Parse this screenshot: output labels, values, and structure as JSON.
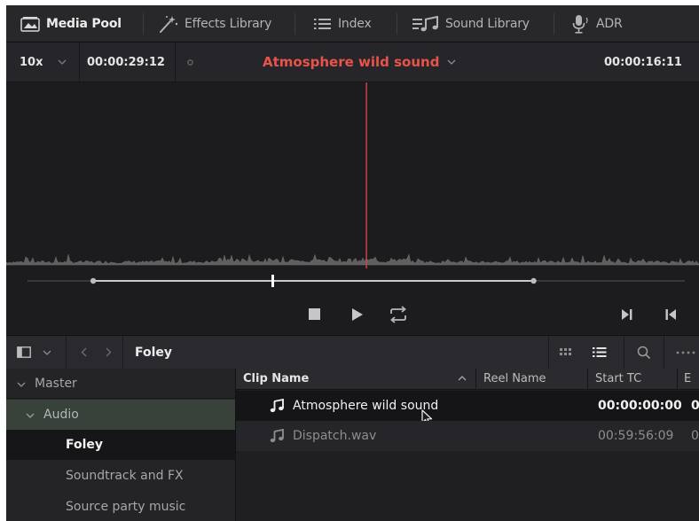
{
  "tabs": [
    {
      "label": "Media Pool",
      "icon": "media-pool-icon",
      "active": true
    },
    {
      "label": "Effects Library",
      "icon": "effects-wand-icon",
      "active": false
    },
    {
      "label": "Index",
      "icon": "index-list-icon",
      "active": false
    },
    {
      "label": "Sound Library",
      "icon": "sound-library-icon",
      "active": false
    },
    {
      "label": "ADR",
      "icon": "microphone-icon",
      "active": false
    }
  ],
  "viewer": {
    "zoom": "10x",
    "duration_tc": "00:00:29:12",
    "clip_title": "Atmosphere wild sound",
    "current_tc": "00:00:16:11",
    "playhead_fraction": 0.52,
    "in_point_fraction": 0.1,
    "out_point_fraction": 0.77
  },
  "pool": {
    "breadcrumb": "Foley",
    "bins": [
      {
        "label": "Master"
      },
      {
        "label": "Audio"
      },
      {
        "label": "Foley"
      },
      {
        "label": "Soundtrack and FX"
      },
      {
        "label": "Source party music"
      }
    ],
    "columns": {
      "clip_name": "Clip Name",
      "reel_name": "Reel Name",
      "start_tc": "Start TC",
      "end_tc": "E"
    },
    "clips": [
      {
        "name": "Atmosphere wild sound",
        "start_tc": "00:00:00:00",
        "end_tc": "0"
      },
      {
        "name": "Dispatch.wav",
        "start_tc": "00:59:56:09",
        "end_tc": "0"
      }
    ]
  },
  "colors": {
    "accent_red": "#e8534a",
    "panel_bg": "#1e1e20",
    "audio_bin_highlight": "#38423a"
  }
}
